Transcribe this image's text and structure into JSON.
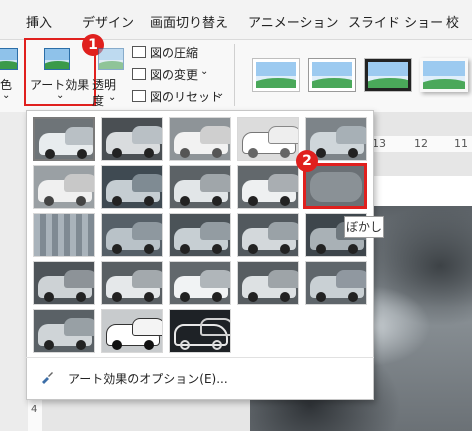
{
  "tabs": [
    {
      "label": "挿入"
    },
    {
      "label": "デザイン"
    },
    {
      "label": "画面切り替え"
    },
    {
      "label": "アニメーション"
    },
    {
      "label": "スライド ショー"
    },
    {
      "label": "校"
    }
  ],
  "ribbon": {
    "color_label": "色",
    "color_arrow": "⌄",
    "art_effects_label": "アート効果",
    "art_effects_arrow": "⌄",
    "transparency_label_1": "透明",
    "transparency_label_2": "度",
    "transparency_arrow": "⌄",
    "compress_label": "図の圧縮",
    "change_label": "図の変更",
    "change_arrow": "⌄",
    "reset_label": "図のリセット",
    "reset_arrow": "⌄"
  },
  "callouts": {
    "step1": "1",
    "step2": "2"
  },
  "tooltip": {
    "text": "ぼかし"
  },
  "menu": {
    "options_label": "アート効果のオプション(E)..."
  },
  "ruler": {
    "marks": [
      "13",
      "12",
      "11"
    ],
    "vertical_mark": "4"
  },
  "colors": {
    "accent_red": "#e0201e",
    "ribbon_bg": "#f8f8f8",
    "selected_border": "#7a7a7a"
  }
}
